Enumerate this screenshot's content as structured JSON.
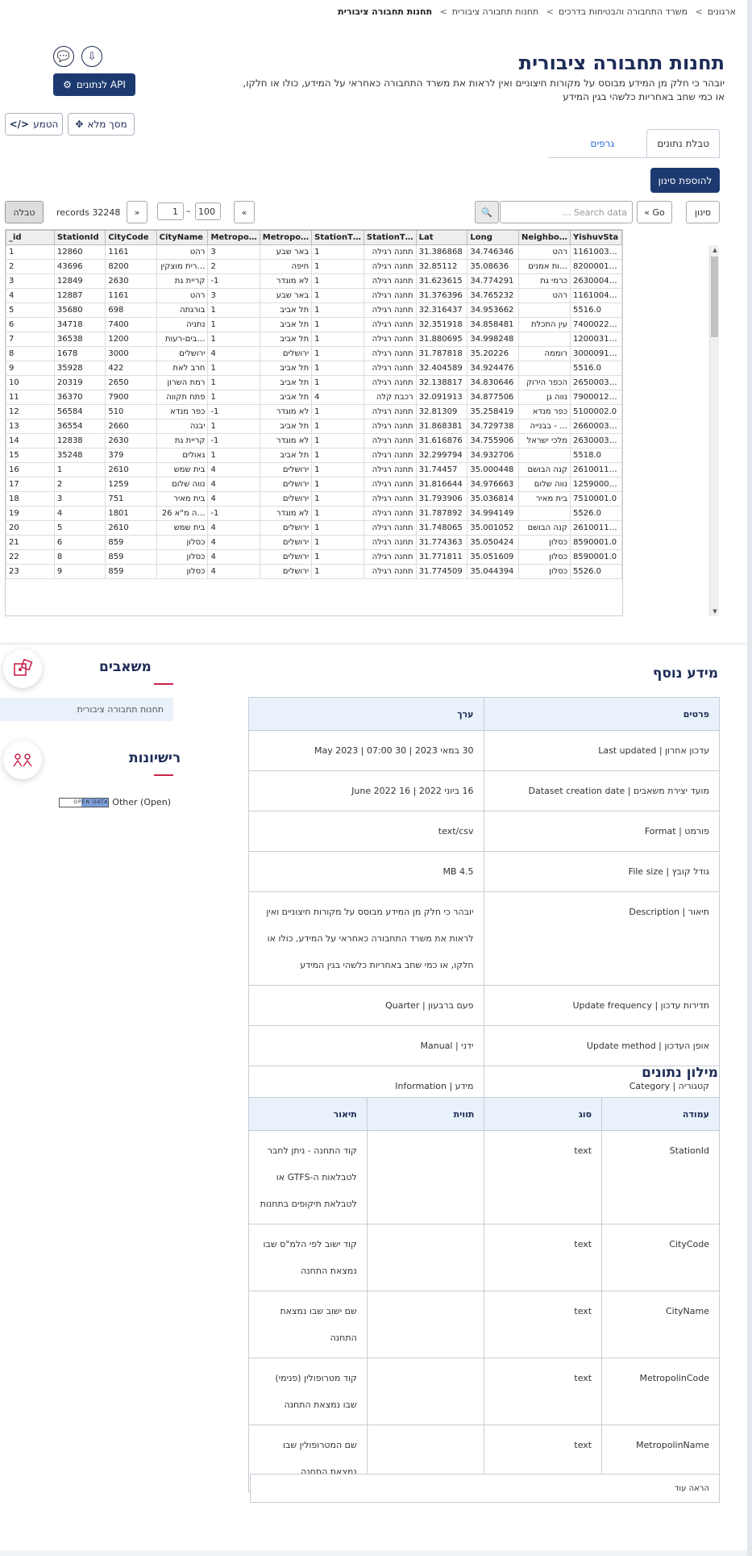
{
  "breadcrumb": [
    "ארגונים",
    "משרד התחבורה והבטיחות בדרכים",
    "תחנות תחבורה ציבורית",
    "תחנות תחבורה ציבורית"
  ],
  "title": "תחנות תחבורה ציבורית",
  "subtitle_line1": "יובהר כי חלק מן המידע מבוסס על מקורות חיצוניים ואין לראות את משרד התחבורה כאחראי על המידע, כולו או חלקו,",
  "subtitle_line2": "או כמי שחב באחריות כלשהי בגין המידע",
  "buttons": {
    "api": "API לנתונים",
    "fullscreen": "מסך מלא",
    "embed": "הטמע",
    "add_filter": "להוספת סינון",
    "filter": "סינון",
    "go": "Go »",
    "table_view": "טבלה"
  },
  "tabs": [
    "טבלת נתונים",
    "גרפים"
  ],
  "search": {
    "placeholder": "Search data ..."
  },
  "pager": {
    "from": "1",
    "to": "100",
    "dash": "–",
    "prev": "«",
    "next": "»"
  },
  "record_count": "32248 records",
  "grid": {
    "columns": [
      "_id",
      "StationId",
      "CityCode",
      "CityName",
      "Metropo…",
      "Metropo…",
      "StationT…",
      "StationT…",
      "Lat",
      "Long",
      "Neighbo…",
      "YishuvSta"
    ],
    "rows": [
      [
        "1",
        "12860",
        "1161",
        "רהט",
        "3",
        "באר שבע",
        "1",
        "תחנה רגילה",
        "31.386868",
        "34.746346",
        "רהט",
        "1161003…"
      ],
      [
        "2",
        "43696",
        "8200",
        "…רית מוצקין",
        "2",
        "חיפה",
        "1",
        "תחנה רגילה",
        "32.85112",
        "35.08636",
        "…ות אמנים",
        "8200001…"
      ],
      [
        "3",
        "12849",
        "2630",
        "קריית גת",
        "-1",
        "לא מוגדר",
        "1",
        "תחנה רגילה",
        "31.623615",
        "34.774291",
        "כרמי גת",
        "2630004…"
      ],
      [
        "4",
        "12887",
        "1161",
        "רהט",
        "3",
        "באר שבע",
        "1",
        "תחנה רגילה",
        "31.376396",
        "34.765232",
        "רהט",
        "1161004…"
      ],
      [
        "5",
        "35680",
        "698",
        "בורגתה",
        "1",
        "תל אביב",
        "1",
        "תחנה רגילה",
        "32.316437",
        "34.953662",
        "",
        "5516.0"
      ],
      [
        "6",
        "34718",
        "7400",
        "נתניה",
        "1",
        "תל אביב",
        "1",
        "תחנה רגילה",
        "32.351918",
        "34.858481",
        "עין התכלת",
        "7400022…"
      ],
      [
        "7",
        "36538",
        "1200",
        "…בים-רעות",
        "1",
        "תל אביב",
        "1",
        "תחנה רגילה",
        "31.880695",
        "34.998248",
        "",
        "1200031…"
      ],
      [
        "8",
        "1678",
        "3000",
        "ירושלים",
        "4",
        "ירושלים",
        "1",
        "תחנה רגילה",
        "31.787818",
        "35.20226",
        "רוממה",
        "3000091…"
      ],
      [
        "9",
        "35928",
        "422",
        "חרב לאת",
        "1",
        "תל אביב",
        "1",
        "תחנה רגילה",
        "32.404589",
        "34.924476",
        "",
        "5516.0"
      ],
      [
        "10",
        "20319",
        "2650",
        "רמת השרון",
        "1",
        "תל אביב",
        "1",
        "תחנה רגילה",
        "32.138817",
        "34.830646",
        "הכפר הירוק",
        "2650003…"
      ],
      [
        "11",
        "36370",
        "7900",
        "פתח תקווה",
        "1",
        "תל אביב",
        "4",
        "רכבת קלה",
        "32.091913",
        "34.877506",
        "נווה גן",
        "7900012…"
      ],
      [
        "12",
        "56584",
        "510",
        "כפר מנדא",
        "-1",
        "לא מוגדר",
        "1",
        "תחנה רגילה",
        "32.81309",
        "35.258419",
        "כפר מנדא",
        "5100002.0"
      ],
      [
        "13",
        "36554",
        "2660",
        "יבנה",
        "1",
        "תל אביב",
        "1",
        "תחנה רגילה",
        "31.868381",
        "34.729738",
        "… - בבנייה",
        "2660003…"
      ],
      [
        "14",
        "12838",
        "2630",
        "קריית גת",
        "-1",
        "לא מוגדר",
        "1",
        "תחנה רגילה",
        "31.616876",
        "34.755906",
        "מלכי ישראל",
        "2630003…"
      ],
      [
        "15",
        "35248",
        "379",
        "גאולים",
        "1",
        "תל אביב",
        "1",
        "תחנה רגילה",
        "32.299794",
        "34.932706",
        "",
        "5518.0"
      ],
      [
        "16",
        "1",
        "2610",
        "בית שמש",
        "4",
        "ירושלים",
        "1",
        "תחנה רגילה",
        "31.74457",
        "35.000448",
        "קנה הבושם",
        "2610011…"
      ],
      [
        "17",
        "2",
        "1259",
        "נווה שלום",
        "4",
        "ירושלים",
        "1",
        "תחנה רגילה",
        "31.816644",
        "34.976663",
        "נווה שלום",
        "1259000…"
      ],
      [
        "18",
        "3",
        "751",
        "בית מאיר",
        "4",
        "ירושלים",
        "1",
        "תחנה רגילה",
        "31.793906",
        "35.036814",
        "בית מאיר",
        "7510001.0"
      ],
      [
        "19",
        "4",
        "1801",
        "…ה מ\"א 26",
        "-1",
        "לא מוגדר",
        "1",
        "תחנה רגילה",
        "31.787892",
        "34.994149",
        "",
        "5526.0"
      ],
      [
        "20",
        "5",
        "2610",
        "בית שמש",
        "4",
        "ירושלים",
        "1",
        "תחנה רגילה",
        "31.748065",
        "35.001052",
        "קנה הבושם",
        "2610011…"
      ],
      [
        "21",
        "6",
        "859",
        "כסלון",
        "4",
        "ירושלים",
        "1",
        "תחנה רגילה",
        "31.774363",
        "35.050424",
        "כסלון",
        "8590001.0"
      ],
      [
        "22",
        "8",
        "859",
        "כסלון",
        "4",
        "ירושלים",
        "1",
        "תחנה רגילה",
        "31.771811",
        "35.051609",
        "כסלון",
        "8590001.0"
      ],
      [
        "23",
        "9",
        "859",
        "כסלון",
        "4",
        "ירושלים",
        "1",
        "תחנה רגילה",
        "31.774509",
        "35.044394",
        "כסלון",
        "5526.0"
      ]
    ]
  },
  "resources": {
    "heading": "משאבים",
    "item": "תחנות תחבורה ציבורית"
  },
  "licenses": {
    "heading": "רישיונות",
    "name": "Other (Open)",
    "badge": "OPEN DATA"
  },
  "info": {
    "heading": "מידע נוסף",
    "col_details": "פרטים",
    "col_value": "ערך",
    "rows": [
      {
        "k": "עדכון אחרון | Last updated",
        "v": "30 במאי 2023 | 30 May 2023 | 07:00"
      },
      {
        "k": "מועד יצירת משאבים | Dataset creation date",
        "v": "16 ביוני 2022 | 16 June 2022"
      },
      {
        "k": "פורמט | Format",
        "v": "text/csv"
      },
      {
        "k": "גודל קובץ | File size",
        "v": "4.5 MB"
      },
      {
        "k": "תיאור | Description",
        "v": "יובהר כי חלק מן המידע מבוסס על מקורות חיצוניים ואין לראות את משרד התחבורה כאחראי על המידע, כולו או חלקו, או כמי שחב באחריות כלשהי בגין המידע"
      },
      {
        "k": "תדירות עדכון | Update frequency",
        "v": "פעם ברבעון | Quarter"
      },
      {
        "k": "אופן העדכון | Update method",
        "v": "ידני | Manual"
      },
      {
        "k": "קטגוריה | Category",
        "v": "מידע | Information"
      }
    ]
  },
  "dictionary": {
    "heading": "מילון נתונים",
    "cols": [
      "עמודה",
      "סוג",
      "תווית",
      "תיאור"
    ],
    "rows": [
      {
        "col": "StationId",
        "type": "text",
        "label": "",
        "desc": "קוד התחנה - ניתן לחבר לטבלאות ה-GTFS או לטבלאת תיקופים בתחנות"
      },
      {
        "col": "CityCode",
        "type": "text",
        "label": "",
        "desc": "קוד ישוב לפי הלמ\"ס שבו נמצאת התחנה"
      },
      {
        "col": "CityName",
        "type": "text",
        "label": "",
        "desc": "שם ישוב שבו נמצאת התחנה"
      },
      {
        "col": "MetropolinCode",
        "type": "text",
        "label": "",
        "desc": "קוד מטרופולין (פנימי) שבו נמצאת התחנה"
      },
      {
        "col": "MetropolinName",
        "type": "text",
        "label": "",
        "desc": "שם המטרופולין שבו נמצאת התחנה"
      }
    ],
    "more": "הראה עוד"
  },
  "colors": {
    "navy": "#1d2c57",
    "button": "#1d3a70",
    "accent": "#c8234c",
    "header_bg": "#e9f1fa"
  }
}
